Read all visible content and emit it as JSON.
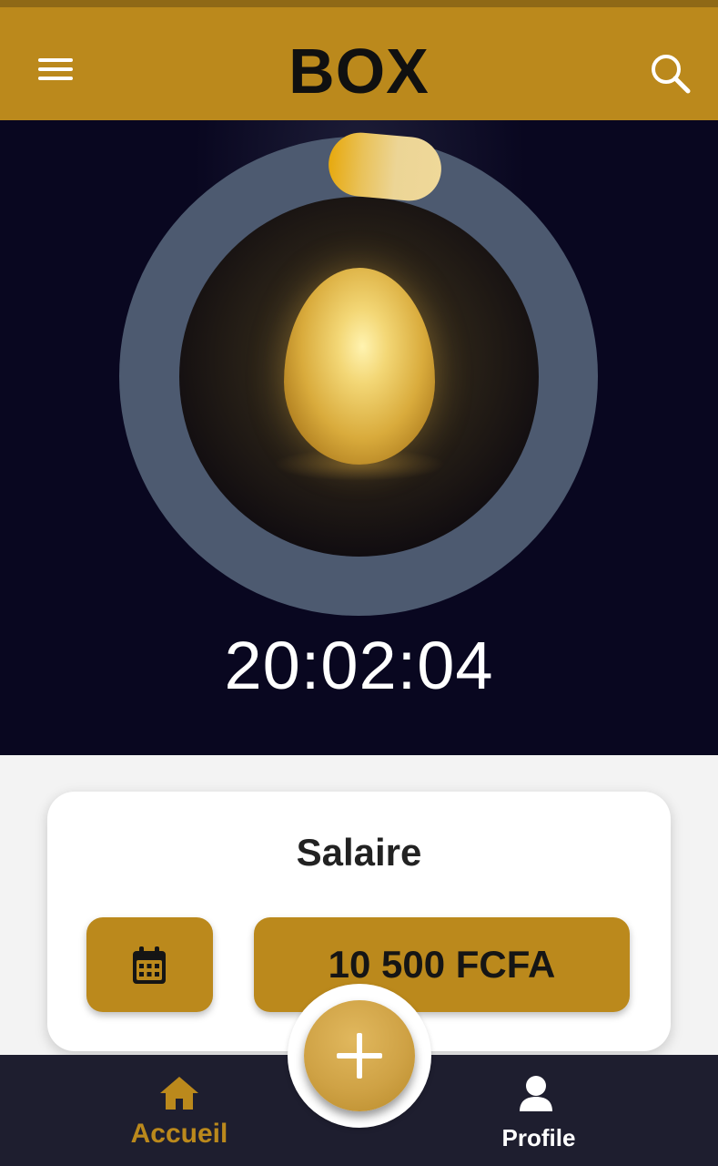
{
  "header": {
    "title": "BOX",
    "menu_icon": "hamburger-menu-icon",
    "search_icon": "search-icon",
    "background_color": "#bb891c"
  },
  "hero": {
    "timer": "20:02:04",
    "centerpiece": "golden-egg",
    "background_color": "#090720",
    "ring_color": "#4d5a70",
    "progress_color": "#e9c25a"
  },
  "salary_card": {
    "title": "Salaire",
    "calendar_icon": "calendar-icon",
    "amount": "10 500 FCFA",
    "button_color": "#bb891c"
  },
  "bottom_nav": {
    "items": [
      {
        "label": "Accueil",
        "icon": "home-icon",
        "active": true
      },
      {
        "label": "Profile",
        "icon": "user-icon",
        "active": false
      }
    ],
    "fab_icon": "plus-icon",
    "background_color": "#1e1e2f",
    "active_color": "#bb891c"
  }
}
